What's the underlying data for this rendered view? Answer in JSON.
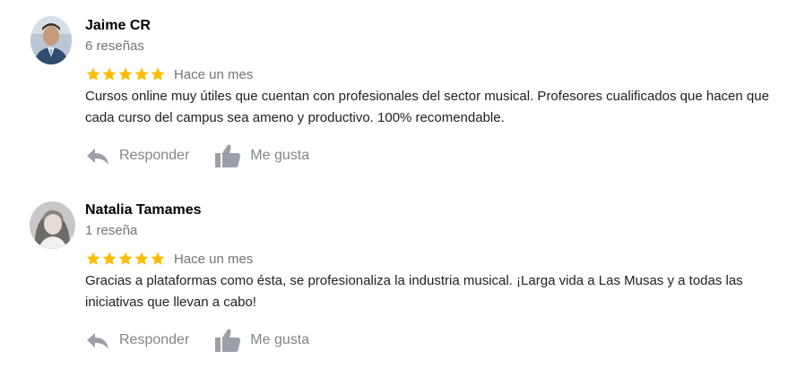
{
  "reviews": [
    {
      "author": "Jaime CR",
      "review_count": "6 reseñas",
      "rating": 5,
      "date": "Hace un mes",
      "text": "Cursos online muy útiles que cuentan con profesionales del sector musical. Profesores cualificados que hacen que cada curso del campus sea ameno y productivo. 100% recomendable.",
      "reply_label": "Responder",
      "like_label": "Me gusta"
    },
    {
      "author": "Natalia Tamames",
      "review_count": "1 reseña",
      "rating": 5,
      "date": "Hace un mes",
      "text": "Gracias a plataformas como ésta, se profesionaliza la industria musical. ¡Larga vida a Las Musas y a todas las iniciativas que llevan a cabo!",
      "reply_label": "Responder",
      "like_label": "Me gusta"
    }
  ],
  "icons": {
    "star": "star-icon",
    "reply": "reply-icon",
    "like": "thumbs-up-icon"
  },
  "colors": {
    "star": "#fbbc04",
    "muted": "#70757a",
    "action": "#80868b"
  }
}
